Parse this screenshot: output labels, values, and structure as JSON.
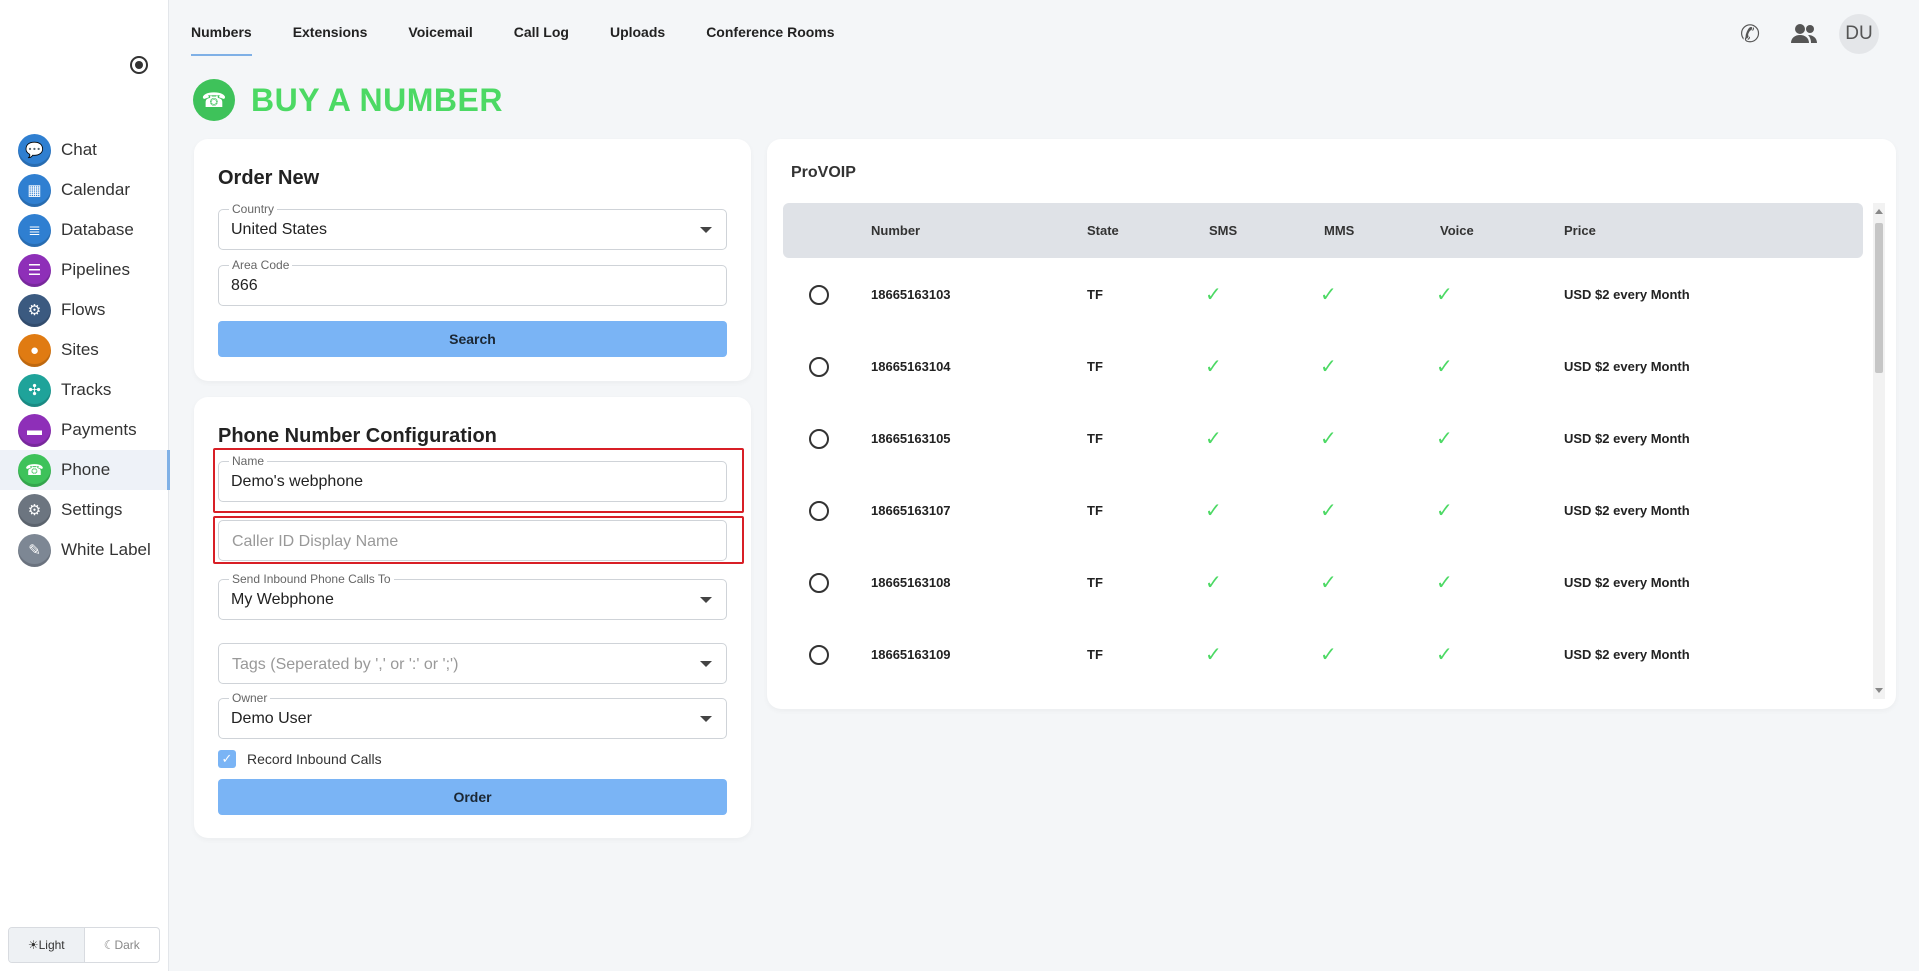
{
  "sidebar": {
    "items": [
      {
        "label": "Chat",
        "icon": "chat-icon",
        "color": "#2f7fd1",
        "glyph": "💬"
      },
      {
        "label": "Calendar",
        "icon": "calendar-icon",
        "color": "#2f7fd1",
        "glyph": "▦"
      },
      {
        "label": "Database",
        "icon": "database-icon",
        "color": "#2f7fd1",
        "glyph": "≣"
      },
      {
        "label": "Pipelines",
        "icon": "pipelines-icon",
        "color": "#8e2fb8",
        "glyph": "☰"
      },
      {
        "label": "Flows",
        "icon": "flows-icon",
        "color": "#3b5a80",
        "glyph": "⚙"
      },
      {
        "label": "Sites",
        "icon": "sites-icon",
        "color": "#e07b12",
        "glyph": "●"
      },
      {
        "label": "Tracks",
        "icon": "tracks-icon",
        "color": "#1fa39a",
        "glyph": "✣"
      },
      {
        "label": "Payments",
        "icon": "payments-icon",
        "color": "#8e2fb8",
        "glyph": "▬"
      },
      {
        "label": "Phone",
        "icon": "phone-icon",
        "color": "#3ec25a",
        "glyph": "☎"
      },
      {
        "label": "Settings",
        "icon": "settings-icon",
        "color": "#6c7580",
        "glyph": "⚙"
      },
      {
        "label": "White Label",
        "icon": "white-label-icon",
        "color": "#7d8794",
        "glyph": "✎"
      }
    ],
    "theme": {
      "light": "☀Light",
      "dark": "☾Dark"
    }
  },
  "topnav": {
    "tabs": [
      "Numbers",
      "Extensions",
      "Voicemail",
      "Call Log",
      "Uploads",
      "Conference Rooms"
    ],
    "avatar": "DU"
  },
  "page": {
    "title": "BUY A NUMBER"
  },
  "order_new": {
    "title": "Order New",
    "country_label": "Country",
    "country_value": "United States",
    "area_code_label": "Area Code",
    "area_code_value": "866",
    "search_label": "Search"
  },
  "config": {
    "title": "Phone Number Configuration",
    "name_label": "Name",
    "name_value": "Demo's webphone",
    "caller_id_placeholder": "Caller ID Display Name",
    "send_label": "Send Inbound Phone Calls To",
    "send_value": "My Webphone",
    "tags_placeholder": "Tags (Seperated by ',' or ':' or ';')",
    "owner_label": "Owner",
    "owner_value": "Demo User",
    "record_label": "Record Inbound Calls",
    "order_label": "Order"
  },
  "numbers_table": {
    "provider": "ProVOIP",
    "columns": [
      "Number",
      "State",
      "SMS",
      "MMS",
      "Voice",
      "Price"
    ],
    "rows": [
      {
        "number": "18665163103",
        "state": "TF",
        "sms": true,
        "mms": true,
        "voice": true,
        "price": "USD $2 every Month"
      },
      {
        "number": "18665163104",
        "state": "TF",
        "sms": true,
        "mms": true,
        "voice": true,
        "price": "USD $2 every Month"
      },
      {
        "number": "18665163105",
        "state": "TF",
        "sms": true,
        "mms": true,
        "voice": true,
        "price": "USD $2 every Month"
      },
      {
        "number": "18665163107",
        "state": "TF",
        "sms": true,
        "mms": true,
        "voice": true,
        "price": "USD $2 every Month"
      },
      {
        "number": "18665163108",
        "state": "TF",
        "sms": true,
        "mms": true,
        "voice": true,
        "price": "USD $2 every Month"
      },
      {
        "number": "18665163109",
        "state": "TF",
        "sms": true,
        "mms": true,
        "voice": true,
        "price": "USD $2 every Month"
      }
    ]
  },
  "colors": {
    "accent": "#4cd964",
    "button": "#7ab4f5",
    "highlight": "#d81f26"
  }
}
